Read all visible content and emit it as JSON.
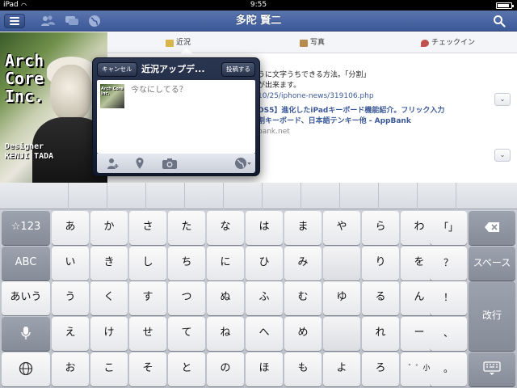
{
  "status": {
    "carrier": "iPad",
    "time": "9:55",
    "battery_level": 0.9
  },
  "nav": {
    "title": "多陀 賢二",
    "icons": [
      "menu-icon",
      "friends-icon",
      "messages-icon",
      "globe-icon",
      "search-icon"
    ]
  },
  "profile_photo": {
    "lines": [
      "Arch",
      "Core",
      "Inc."
    ],
    "designer_lines": [
      "Designer",
      "KENJI TADA"
    ]
  },
  "tabs": [
    {
      "label": "近況",
      "icon": "status-icon",
      "active": true
    },
    {
      "label": "写真",
      "icon": "photo-icon",
      "active": false
    },
    {
      "label": "チェックイン",
      "icon": "checkin-icon",
      "active": false
    }
  ],
  "feed": {
    "lines": [
      "うに文字うちできる方法。「分割」",
      "が出来ます。",
      "10/25/iphone-news/319106.php",
      "OS5】進化したiPadキーボード機能紹介。フリック入力",
      "割キーボード、日本語テンキー他 - AppBank",
      "bank.net"
    ]
  },
  "compose": {
    "cancel_label": "キャンセル",
    "title": "近況アップデ...",
    "post_label": "投稿する",
    "placeholder": "今なにしてる？",
    "thumb_text": "Arch Core Inc.",
    "toolbar_icons": [
      "tag-friend-icon",
      "location-icon",
      "camera-icon",
      "audience-globe-icon"
    ]
  },
  "keyboard": {
    "left_keys": [
      "☆123",
      "ABC",
      "あいう",
      "mic-icon",
      "globe-icon"
    ],
    "rows": [
      [
        "あ",
        "か",
        "さ",
        "た",
        "な",
        "は",
        "ま",
        "や",
        "ら",
        "わ",
        "「」"
      ],
      [
        "い",
        "き",
        "し",
        "ち",
        "に",
        "ひ",
        "み",
        "",
        "り",
        "を",
        "？"
      ],
      [
        "う",
        "く",
        "す",
        "つ",
        "ぬ",
        "ふ",
        "む",
        "ゆ",
        "る",
        "ん",
        "！"
      ],
      [
        "え",
        "け",
        "せ",
        "て",
        "ね",
        "へ",
        "め",
        "",
        "れ",
        "ー",
        "、"
      ],
      [
        "お",
        "こ",
        "そ",
        "と",
        "の",
        "ほ",
        "も",
        "よ",
        "ろ",
        "゛゜小",
        "。"
      ]
    ],
    "delete_icon": "delete-icon",
    "space_label": "スペース",
    "return_label": "改行",
    "hide_keyboard_icon": "hide-keyboard-icon"
  }
}
